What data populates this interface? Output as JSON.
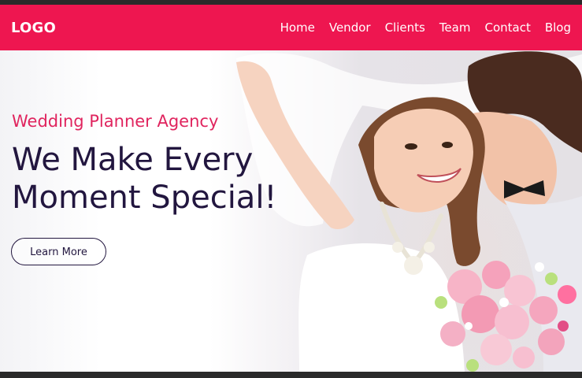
{
  "header": {
    "logo": "LOGO",
    "nav": [
      {
        "label": "Home"
      },
      {
        "label": "Vendor"
      },
      {
        "label": "Clients"
      },
      {
        "label": "Team"
      },
      {
        "label": "Contact"
      },
      {
        "label": "Blog"
      }
    ]
  },
  "hero": {
    "subtitle": "Wedding Planner Agency",
    "title_line1": "We Make Every",
    "title_line2": "Moment Special!",
    "cta_label": "Learn More"
  },
  "colors": {
    "brand": "#ee1650",
    "title": "#22163f",
    "subtitle": "#e0245e"
  }
}
